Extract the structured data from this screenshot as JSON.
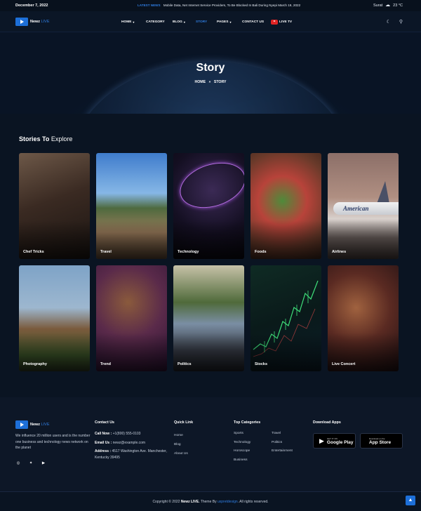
{
  "topbar": {
    "date": "December 7, 2022",
    "ticker_tag": "LATEST NEWS",
    "ticker_text": "Mobile Data, Net Internet Service Providers, To Be Blocked In Bali During Nyepi March 19, 2022",
    "city": "Surat",
    "weather_icon": "cloud-icon",
    "temperature": "23 °C"
  },
  "nav": {
    "logo_name": "Newz",
    "logo_live": "LIVE",
    "items": [
      {
        "label": "HOME",
        "has_dropdown": true
      },
      {
        "label": "CATEGORY",
        "has_dropdown": false
      },
      {
        "label": "BLOG",
        "has_dropdown": true
      },
      {
        "label": "STORY",
        "has_dropdown": false,
        "active": true
      },
      {
        "label": "PAGES",
        "has_dropdown": true
      },
      {
        "label": "CONTACT US",
        "has_dropdown": false
      },
      {
        "label": "LIVE TV",
        "has_dropdown": false
      }
    ]
  },
  "hero": {
    "title": "Story",
    "breadcrumb_home": "HOME",
    "breadcrumb_sep": "»",
    "breadcrumb_current": "STORY"
  },
  "stories": {
    "heading_bold": "Stories To",
    "heading_light": "Explore",
    "cards": [
      {
        "label": "Chef Tricks"
      },
      {
        "label": "Travel"
      },
      {
        "label": "Technology"
      },
      {
        "label": "Foods"
      },
      {
        "label": "Airlines"
      },
      {
        "label": "Photography"
      },
      {
        "label": "Trend"
      },
      {
        "label": "Politics"
      },
      {
        "label": "Stocks"
      },
      {
        "label": "Live Concert"
      }
    ],
    "airline_text": "American"
  },
  "footer": {
    "about": "We influence 20 million users and is the number one business and technology news network on the planet",
    "contact": {
      "title": "Contact Us",
      "phone_label": "Call Now :",
      "phone": "+1(800) 555-0103",
      "email_label": "Email Us :",
      "email": "newz@example.com",
      "address_label": "Address :",
      "address": "4517 Washington Ave. Manchester, Kentucky 39495"
    },
    "quick_link": {
      "title": "Quick Link",
      "links": [
        "Home",
        "Blog",
        "About Us"
      ]
    },
    "top_categories": {
      "title": "Top Categories",
      "items": [
        "Sports",
        "Travel",
        "Technology",
        "Politics",
        "Horoscope",
        "Entertainment",
        "Business"
      ]
    },
    "apps": {
      "title": "Download Apps",
      "google_small": "GET IT ON",
      "google_big": "Google Play",
      "apple_small": "Download on the",
      "apple_big": "App Store"
    },
    "socials": [
      "instagram-icon",
      "twitter-icon",
      "youtube-icon"
    ]
  },
  "bottom": {
    "copy_prefix": "Copyright © 2022",
    "copy_brand": "Newz LIVE.",
    "copy_mid": "Theme By",
    "copy_author": "uxpretdesign",
    "copy_suffix": ". All rights reserved."
  }
}
